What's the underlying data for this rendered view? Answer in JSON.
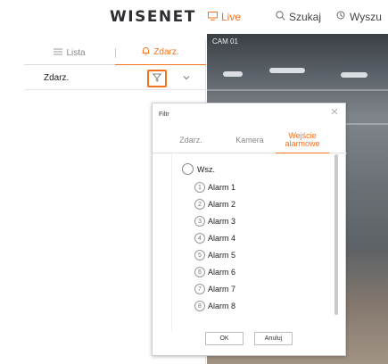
{
  "app": {
    "logo": "WISENET"
  },
  "nav": {
    "live": {
      "label": "Live",
      "icon": "monitor-icon",
      "color": "#f37321"
    },
    "search": {
      "label": "Szukaj",
      "icon": "search-icon"
    },
    "find": {
      "label": "Wyszu",
      "icon": "clock-search-icon"
    }
  },
  "left_panel": {
    "tabs": [
      {
        "label": "Lista",
        "icon": "list-icon",
        "active": false
      },
      {
        "label": "Zdarz.",
        "icon": "bell-icon",
        "active": true
      }
    ],
    "event_filter_label": "Zdarz."
  },
  "camera": {
    "label": "CAM 01"
  },
  "filter_dialog": {
    "title": "Filtr",
    "tabs": [
      {
        "label": "Zdarz.",
        "active": false
      },
      {
        "label": "Kamera",
        "active": false
      },
      {
        "label": "Wejście alarmowe",
        "active": true
      }
    ],
    "all_option": "Wsz.",
    "alarms": [
      {
        "number": "1",
        "label": "Alarm 1"
      },
      {
        "number": "2",
        "label": "Alarm 2"
      },
      {
        "number": "3",
        "label": "Alarm 3"
      },
      {
        "number": "4",
        "label": "Alarm 4"
      },
      {
        "number": "5",
        "label": "Alarm 5"
      },
      {
        "number": "6",
        "label": "Alarm 6"
      },
      {
        "number": "7",
        "label": "Alarm 7"
      },
      {
        "number": "8",
        "label": "Alarm 8"
      }
    ],
    "ok_label": "OK",
    "cancel_label": "Anuluj"
  },
  "colors": {
    "accent": "#f37321"
  }
}
